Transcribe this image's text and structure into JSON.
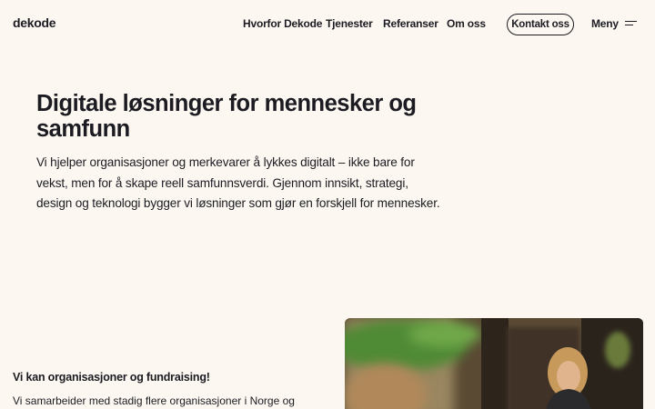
{
  "header": {
    "logo": "dekode",
    "nav": [
      {
        "label": "Hvorfor Dekode"
      },
      {
        "label": "Tjenester"
      },
      {
        "label": "Referanser"
      },
      {
        "label": "Om oss"
      }
    ],
    "contact_label": "Kontakt oss",
    "menu_label": "Meny"
  },
  "hero": {
    "title": "Digitale løsninger for mennesker og samfunn",
    "lead": "Vi hjelper organisasjoner og merkevarer å lykkes digitalt – ikke bare for vekst, men for å skape reell samfunnsverdi. Gjennom innsikt, strategi, design og teknologi bygger vi løsninger som gjør en forskjell for mennesker."
  },
  "section": {
    "heading": "Vi kan organisasjoner og fundraising!",
    "text": "Vi samarbeider med stadig flere organisasjoner i Norge og"
  },
  "colors": {
    "background": "#fcf8f1",
    "text": "#1c1b22"
  },
  "icons": {
    "menu": "hamburger-menu-icon"
  }
}
